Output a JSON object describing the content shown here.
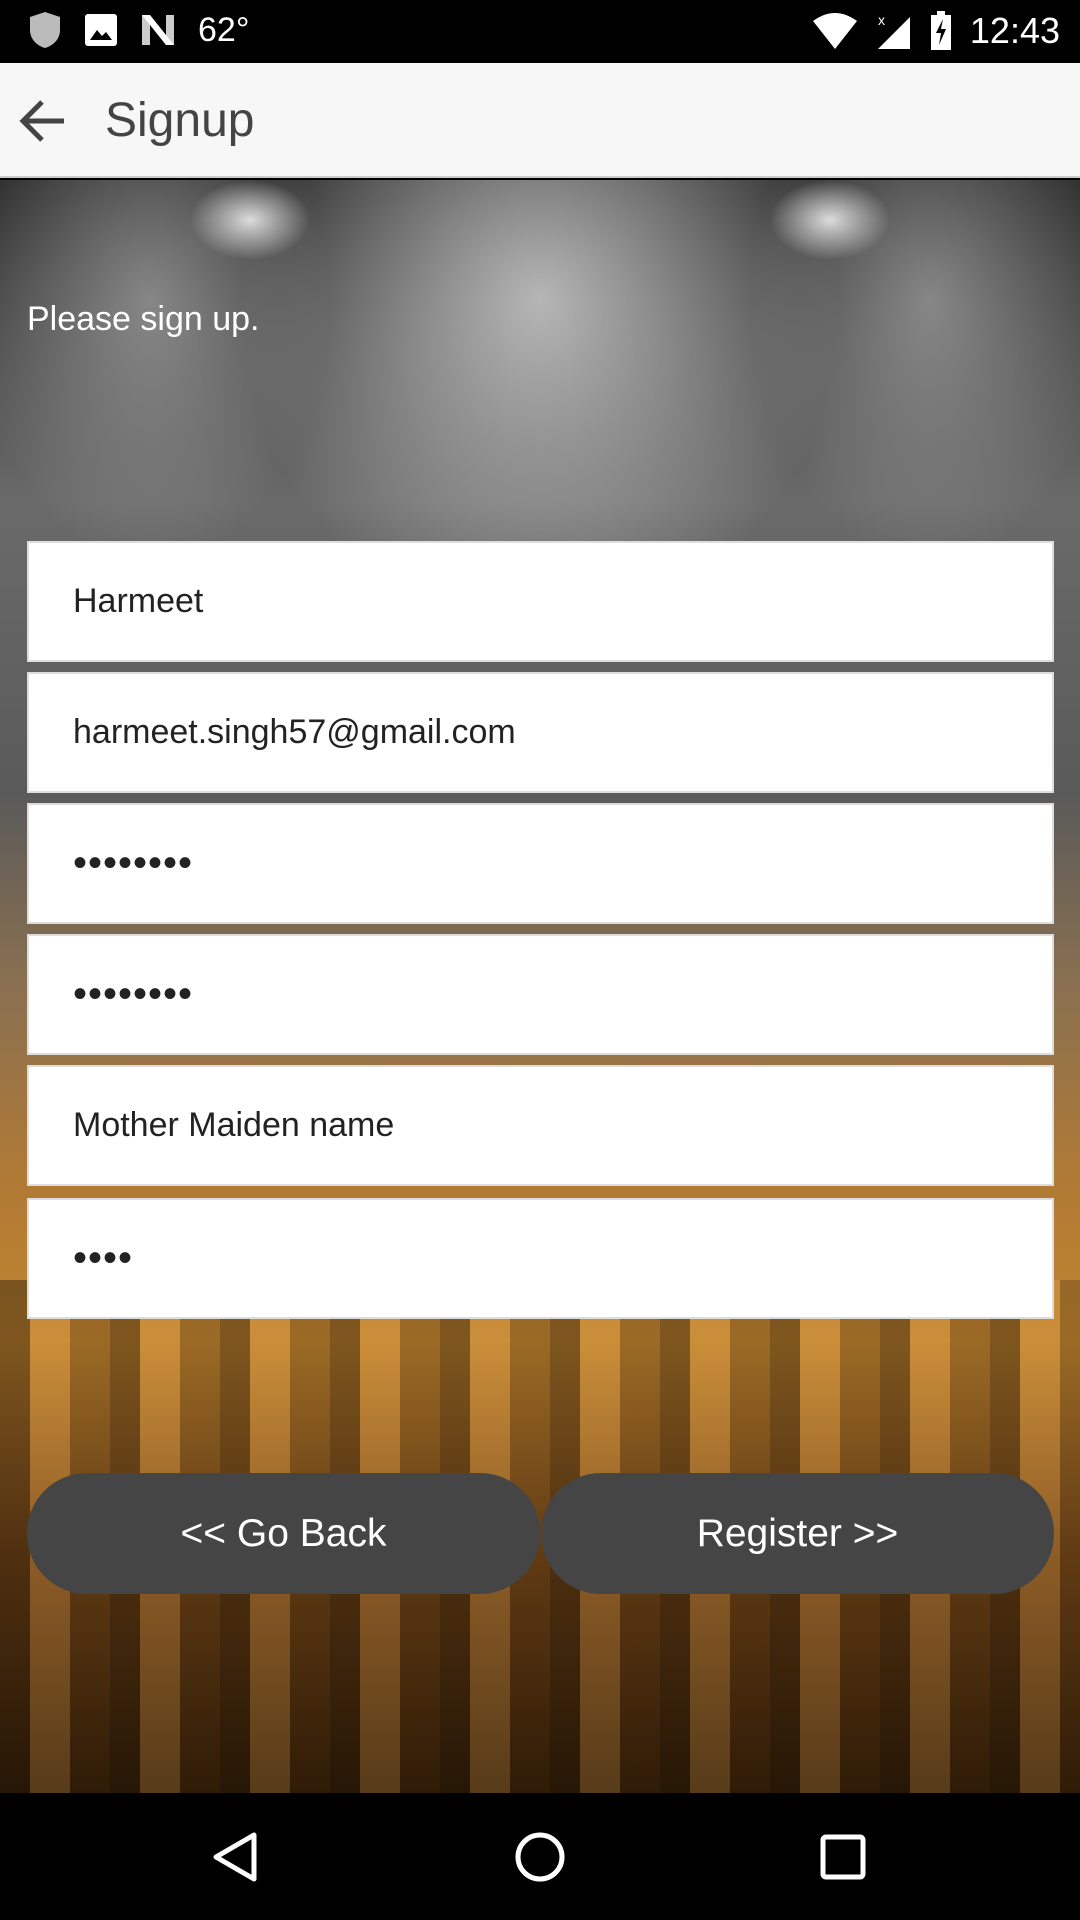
{
  "status_bar": {
    "temperature": "62°",
    "time": "12:43"
  },
  "app_bar": {
    "title": "Signup"
  },
  "form": {
    "prompt": "Please sign up.",
    "fields": [
      {
        "name": "name",
        "value": "Harmeet"
      },
      {
        "name": "email",
        "value": "harmeet.singh57@gmail.com"
      },
      {
        "name": "password",
        "value": "••••••••"
      },
      {
        "name": "confirm-password",
        "value": "••••••••"
      },
      {
        "name": "security-question",
        "value": "Mother Maiden name"
      },
      {
        "name": "security-answer",
        "value": "••••"
      }
    ],
    "go_back_label": "<< Go Back",
    "register_label": "Register >>"
  }
}
